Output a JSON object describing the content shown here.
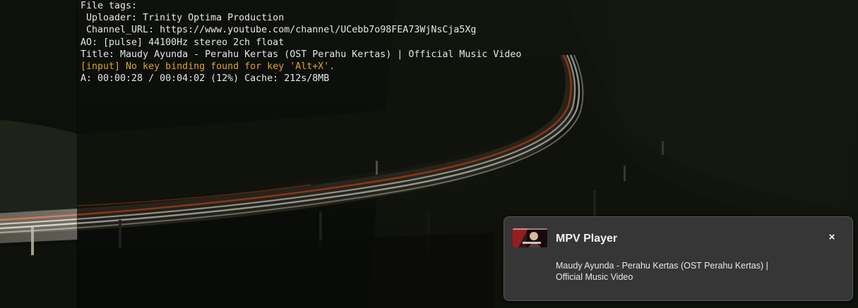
{
  "colors": {
    "terminal_text": "#e6e6e6",
    "terminal_warning": "#e3a31e",
    "notification_bg": "#363636",
    "notification_border": "#5a5a5a"
  },
  "terminal": {
    "lines": [
      {
        "text": "File tags:",
        "kind": "normal"
      },
      {
        "text": " Uploader: Trinity Optima Production",
        "kind": "normal"
      },
      {
        "text": " Channel_URL: https://www.youtube.com/channel/UCebb7o98FEA73WjNsCja5Xg",
        "kind": "normal"
      },
      {
        "text": "AO: [pulse] 44100Hz stereo 2ch float",
        "kind": "normal"
      },
      {
        "text": "Title: Maudy Ayunda - Perahu Kertas (OST Perahu Kertas) | Official Music Video",
        "kind": "normal"
      },
      {
        "text": "[input] No key binding found for key 'Alt+X'.",
        "kind": "warning"
      },
      {
        "text": "A: 00:00:28 / 00:04:02 (12%) Cache: 212s/8MB",
        "kind": "normal"
      }
    ]
  },
  "notification": {
    "app_name": "MPV Player",
    "icon": "video-thumbnail-icon",
    "close_glyph": "×",
    "body": "Maudy Ayunda - Perahu Kertas (OST Perahu Kertas) |",
    "body_line2": "Official Music Video"
  }
}
